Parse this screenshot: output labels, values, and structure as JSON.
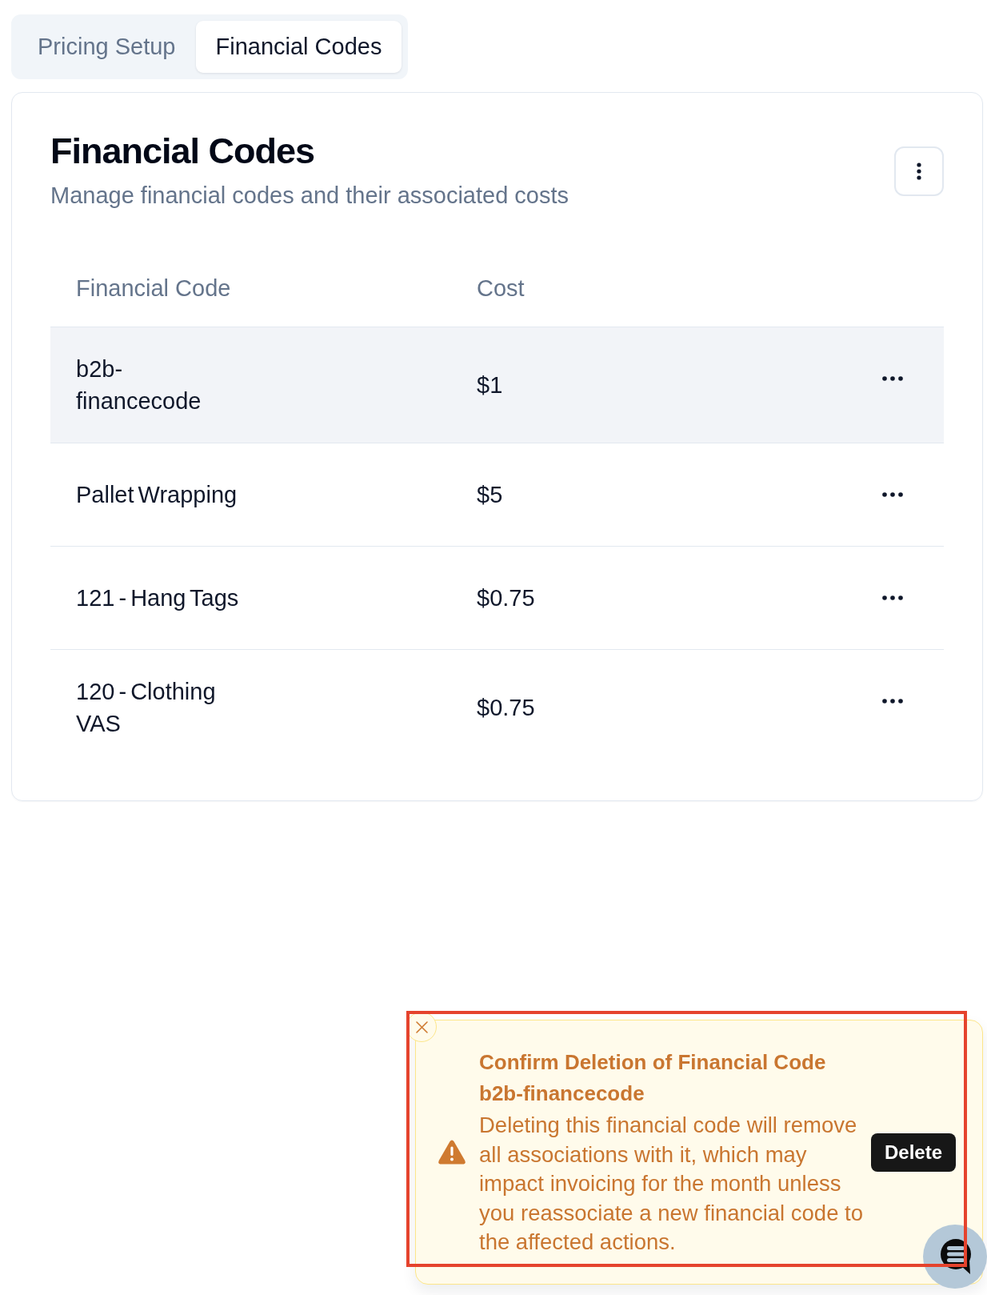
{
  "tabs": [
    {
      "label": "Pricing Setup",
      "selected": false
    },
    {
      "label": "Financial Codes",
      "selected": true
    }
  ],
  "card": {
    "title": "Financial Codes",
    "subtitle": "Manage financial codes and their associated costs"
  },
  "table": {
    "columns": [
      "Financial Code",
      "Cost"
    ],
    "rows": [
      {
        "financial_code": "b2b-financecode",
        "cost": "$1",
        "selected": true
      },
      {
        "financial_code": "Pallet Wrapping",
        "cost": "$5",
        "selected": false
      },
      {
        "financial_code": "121 - Hang Tags",
        "cost": "$0.75",
        "selected": false
      },
      {
        "financial_code": "120 - Clothing VAS",
        "cost": "$0.75",
        "selected": false
      }
    ]
  },
  "toast": {
    "kind": "warning",
    "title": "Confirm Deletion of Financial Code b2b-financecode",
    "message": "Deleting this financial code will remove all associations with it, which may impact invoicing for the month unless you reassociate a new financial code to the affected actions.",
    "action": "Delete",
    "highlighted": true
  }
}
